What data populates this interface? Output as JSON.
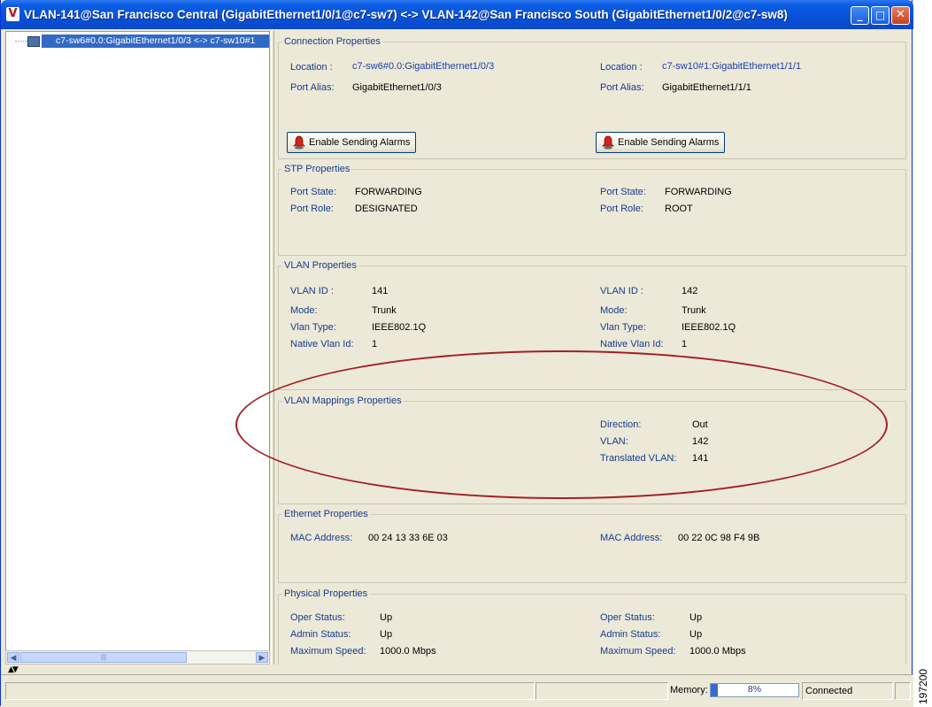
{
  "window": {
    "title": "VLAN-141@San Francisco Central (GigabitEthernet1/0/1@c7-sw7) <-> VLAN-142@San Francisco South (GigabitEthernet1/0/2@c7-sw8)",
    "app_icon_letter": "V"
  },
  "tree": {
    "selected_node": "c7-sw6#0.0:GigabitEthernet1/0/3 <-> c7-sw10#1"
  },
  "connection": {
    "legend": "Connection Properties",
    "left": {
      "location_label": "Location :",
      "location_value": "c7-sw6#0.0:GigabitEthernet1/0/3",
      "alias_label": "Port Alias:",
      "alias_value": "GigabitEthernet1/0/3",
      "button_label": "Enable Sending Alarms"
    },
    "right": {
      "location_label": "Location :",
      "location_value": "c7-sw10#1:GigabitEthernet1/1/1",
      "alias_label": "Port Alias:",
      "alias_value": "GigabitEthernet1/1/1",
      "button_label": "Enable Sending Alarms"
    }
  },
  "stp": {
    "legend": "STP Properties",
    "left": {
      "state_label": "Port State:",
      "state_value": "FORWARDING",
      "role_label": "Port Role:",
      "role_value": "DESIGNATED"
    },
    "right": {
      "state_label": "Port State:",
      "state_value": "FORWARDING",
      "role_label": "Port Role:",
      "role_value": "ROOT"
    }
  },
  "vlan": {
    "legend": "VLAN Properties",
    "left": {
      "id_label": "VLAN ID :",
      "id_value": "141",
      "mode_label": "Mode:",
      "mode_value": "Trunk",
      "type_label": "Vlan Type:",
      "type_value": "IEEE802.1Q",
      "native_label": "Native Vlan Id:",
      "native_value": "1"
    },
    "right": {
      "id_label": "VLAN ID :",
      "id_value": "142",
      "mode_label": "Mode:",
      "mode_value": "Trunk",
      "type_label": "Vlan Type:",
      "type_value": "IEEE802.1Q",
      "native_label": "Native Vlan Id:",
      "native_value": "1"
    }
  },
  "mapping": {
    "legend": "VLAN Mappings Properties",
    "direction_label": "Direction:",
    "direction_value": "Out",
    "vlan_label": "VLAN:",
    "vlan_value": "142",
    "translated_label": "Translated VLAN:",
    "translated_value": "141"
  },
  "ethernet": {
    "legend": "Ethernet Properties",
    "left": {
      "mac_label": "MAC Address:",
      "mac_value": "00 24 13 33 6E 03"
    },
    "right": {
      "mac_label": "MAC Address:",
      "mac_value": "00 22 0C 98 F4 9B"
    }
  },
  "physical": {
    "legend": "Physical Properties",
    "left": {
      "oper_label": "Oper Status:",
      "oper_value": "Up",
      "admin_label": "Admin Status:",
      "admin_value": "Up",
      "speed_label": "Maximum Speed:",
      "speed_value": "1000.0 Mbps"
    },
    "right": {
      "oper_label": "Oper Status:",
      "oper_value": "Up",
      "admin_label": "Admin Status:",
      "admin_value": "Up",
      "speed_label": "Maximum Speed:",
      "speed_value": "1000.0 Mbps"
    }
  },
  "statusbar": {
    "memory_label": "Memory:",
    "memory_percent": 8,
    "memory_text": "8%",
    "connection_status": "Connected"
  },
  "figure_id": "197200",
  "colors": {
    "highlight_ellipse": "#a31f24",
    "titlebar": "#0851d8",
    "label": "#1a3a8c"
  }
}
